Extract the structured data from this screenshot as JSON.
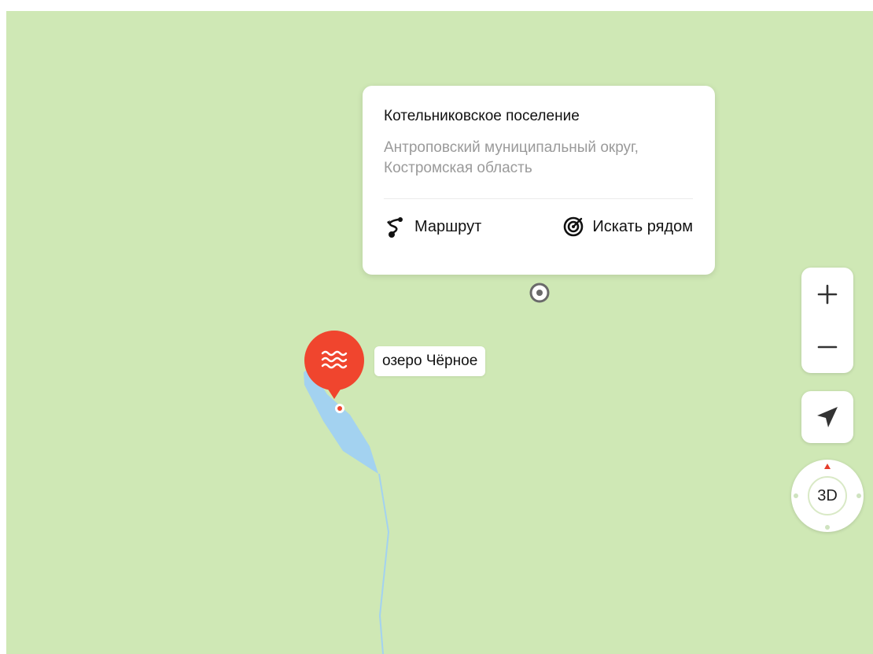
{
  "popup": {
    "title": "Котельниковское поселение",
    "subtitle": "Антроповский муниципальный округ, Костромская область",
    "actions": {
      "route": {
        "label": "Маршрут",
        "icon": "route-icon"
      },
      "search_nearby": {
        "label": "Искать рядом",
        "icon": "search-nearby-icon"
      }
    }
  },
  "lake": {
    "label": "озеро Чёрное",
    "icon": "water-waves-icon"
  },
  "controls": {
    "zoom_in": {
      "icon": "plus-icon"
    },
    "zoom_out": {
      "icon": "minus-icon"
    },
    "locate": {
      "icon": "location-arrow-icon"
    },
    "compass": {
      "label": "3D",
      "icon": "compass-icon"
    }
  },
  "colors": {
    "land": "#cfe8b5",
    "water": "#a3d2f0",
    "pin": "#f0452e",
    "text_primary": "#111111",
    "text_secondary": "#9a9a9a"
  }
}
